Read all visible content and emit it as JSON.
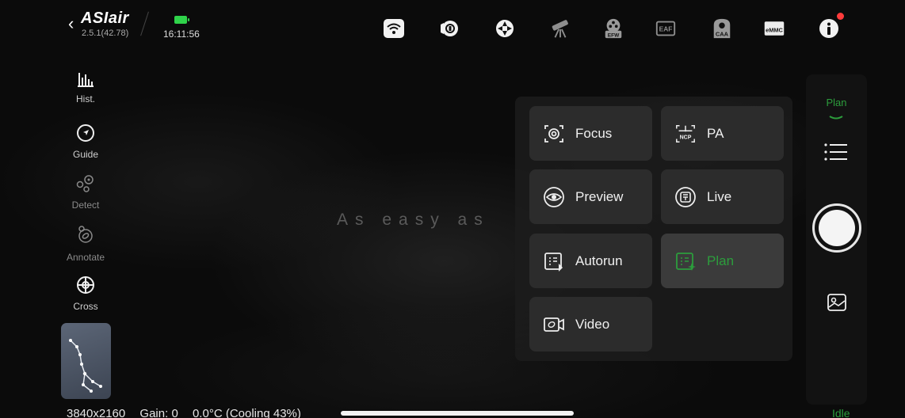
{
  "topbar": {
    "app_logo": "ASIair",
    "version": "2.5.1(42.78)",
    "time": "16:11:56",
    "battery_color": "#2fd34a",
    "status_icons": [
      {
        "name": "wifi-icon"
      },
      {
        "name": "camera-icon"
      },
      {
        "name": "mount-icon"
      },
      {
        "name": "telescope-icon"
      },
      {
        "name": "efw-icon",
        "label": "EFW"
      },
      {
        "name": "eaf-icon",
        "label": "EAF"
      },
      {
        "name": "caa-icon",
        "label": "CAA"
      },
      {
        "name": "emmc-icon",
        "label": "eMMC"
      },
      {
        "name": "info-icon"
      }
    ]
  },
  "left_toolbar": {
    "items": [
      {
        "label": "Hist.",
        "icon": "histogram-icon"
      },
      {
        "label": "Guide",
        "icon": "guide-icon"
      },
      {
        "label": "Detect",
        "icon": "detect-icon"
      },
      {
        "label": "Annotate",
        "icon": "annotate-icon"
      },
      {
        "label": "Cross",
        "icon": "crosshair-icon"
      }
    ]
  },
  "watermark": "As easy as",
  "menu": {
    "items": [
      {
        "label": "Focus",
        "icon": "focus-icon"
      },
      {
        "label": "PA",
        "icon": "ncp-icon",
        "icon_text": "NCP"
      },
      {
        "label": "Preview",
        "icon": "eye-icon"
      },
      {
        "label": "Live",
        "icon": "live-icon"
      },
      {
        "label": "Autorun",
        "icon": "autorun-icon"
      },
      {
        "label": "Plan",
        "icon": "plan-icon",
        "active": true
      },
      {
        "label": "Video",
        "icon": "video-icon"
      }
    ]
  },
  "right_rail": {
    "tab_label": "Plan",
    "idle_label": "Idle"
  },
  "status_bar": {
    "resolution": "3840x2160",
    "gain": "Gain: 0",
    "temperature": "0.0°C (Cooling 43%)"
  },
  "colors": {
    "accent": "#2c9d3c",
    "alert": "#ff3b3b"
  }
}
